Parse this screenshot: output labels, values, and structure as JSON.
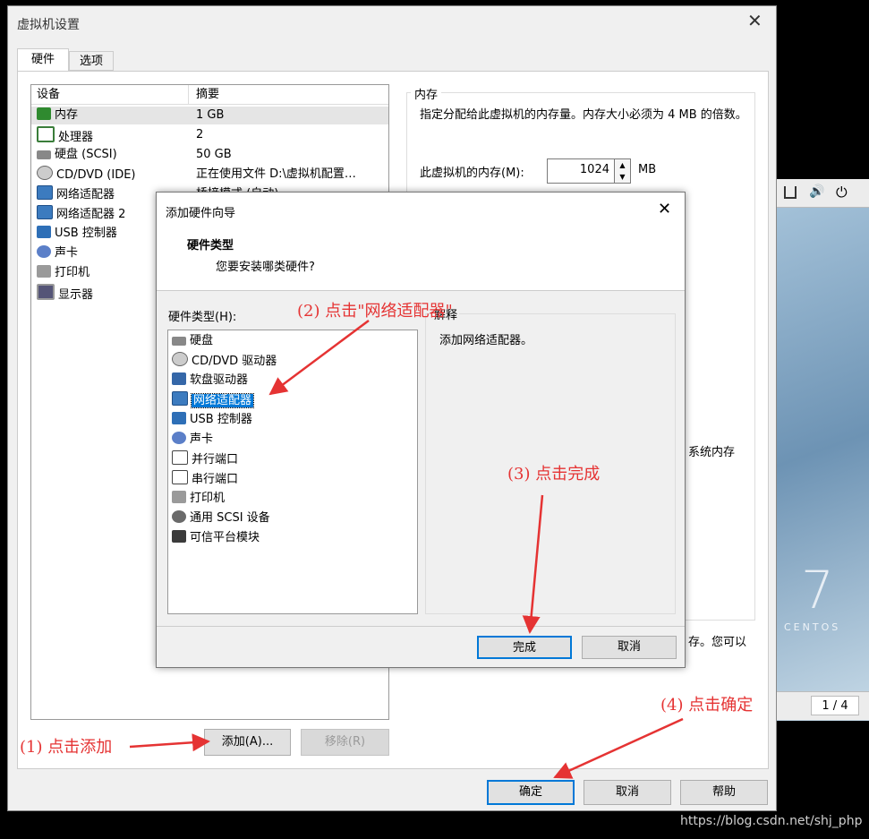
{
  "vm_window": {
    "title": "虚拟机设置",
    "tabs": [
      "硬件",
      "选项"
    ],
    "device_table": {
      "headers": [
        "设备",
        "摘要"
      ],
      "rows": [
        {
          "device": "内存",
          "summary": "1 GB",
          "icon": "memory-icon"
        },
        {
          "device": "处理器",
          "summary": "2",
          "icon": "cpu-icon"
        },
        {
          "device": "硬盘 (SCSI)",
          "summary": "50 GB",
          "icon": "hard-disk-icon"
        },
        {
          "device": "CD/DVD (IDE)",
          "summary": "正在使用文件 D:\\虚拟机配置…",
          "icon": "cd-dvd-icon"
        },
        {
          "device": "网络适配器",
          "summary": "桥接模式 (自动)",
          "icon": "network-adapter-icon"
        },
        {
          "device": "网络适配器 2",
          "summary": "",
          "icon": "network-adapter-icon"
        },
        {
          "device": "USB 控制器",
          "summary": "",
          "icon": "usb-icon"
        },
        {
          "device": "声卡",
          "summary": "",
          "icon": "sound-card-icon"
        },
        {
          "device": "打印机",
          "summary": "",
          "icon": "printer-icon"
        },
        {
          "device": "显示器",
          "summary": "",
          "icon": "display-icon"
        }
      ]
    },
    "add_button": "添加(A)...",
    "remove_button": "移除(R)",
    "memory_group": {
      "title": "内存",
      "description": "指定分配给此虚拟机的内存量。内存大小必须为 4 MB 的倍数。",
      "field_label": "此虚拟机的内存(M):",
      "value": "1024",
      "unit": "MB",
      "partial_text_1": "系统内存",
      "partial_text_2": "存。您可以"
    },
    "ok_button": "确定",
    "cancel_button": "取消",
    "help_button": "帮助"
  },
  "wizard": {
    "title": "添加硬件向导",
    "heading": "硬件类型",
    "subheading": "您要安装哪类硬件?",
    "list_label": "硬件类型(H):",
    "items": [
      {
        "label": "硬盘",
        "icon": "hard-disk-icon"
      },
      {
        "label": "CD/DVD 驱动器",
        "icon": "cd-dvd-icon"
      },
      {
        "label": "软盘驱动器",
        "icon": "floppy-icon"
      },
      {
        "label": "网络适配器",
        "icon": "network-adapter-icon"
      },
      {
        "label": "USB 控制器",
        "icon": "usb-icon"
      },
      {
        "label": "声卡",
        "icon": "sound-card-icon"
      },
      {
        "label": "并行端口",
        "icon": "parallel-port-icon"
      },
      {
        "label": "串行端口",
        "icon": "serial-port-icon"
      },
      {
        "label": "打印机",
        "icon": "printer-icon"
      },
      {
        "label": "通用 SCSI 设备",
        "icon": "scsi-icon"
      },
      {
        "label": "可信平台模块",
        "icon": "tpm-chip-icon"
      }
    ],
    "selected_index": 3,
    "explain_label": "解释",
    "explain_text": "添加网络适配器。",
    "finish_button": "完成",
    "cancel_button": "取消"
  },
  "annotations": {
    "step1": "(1) 点击添加",
    "step2": "(2) 点击\"网络适配器\"",
    "step3": "(3) 点击完成",
    "step4": "(4) 点击确定"
  },
  "background": {
    "centos_number": "7",
    "centos_text": "CENTOS",
    "page_indicator": "1 / 4",
    "watermark": "https://blog.csdn.net/shj_php"
  },
  "colors": {
    "selection": "#0078d7",
    "annotation": "#e53333",
    "accent": "#0078d7"
  }
}
